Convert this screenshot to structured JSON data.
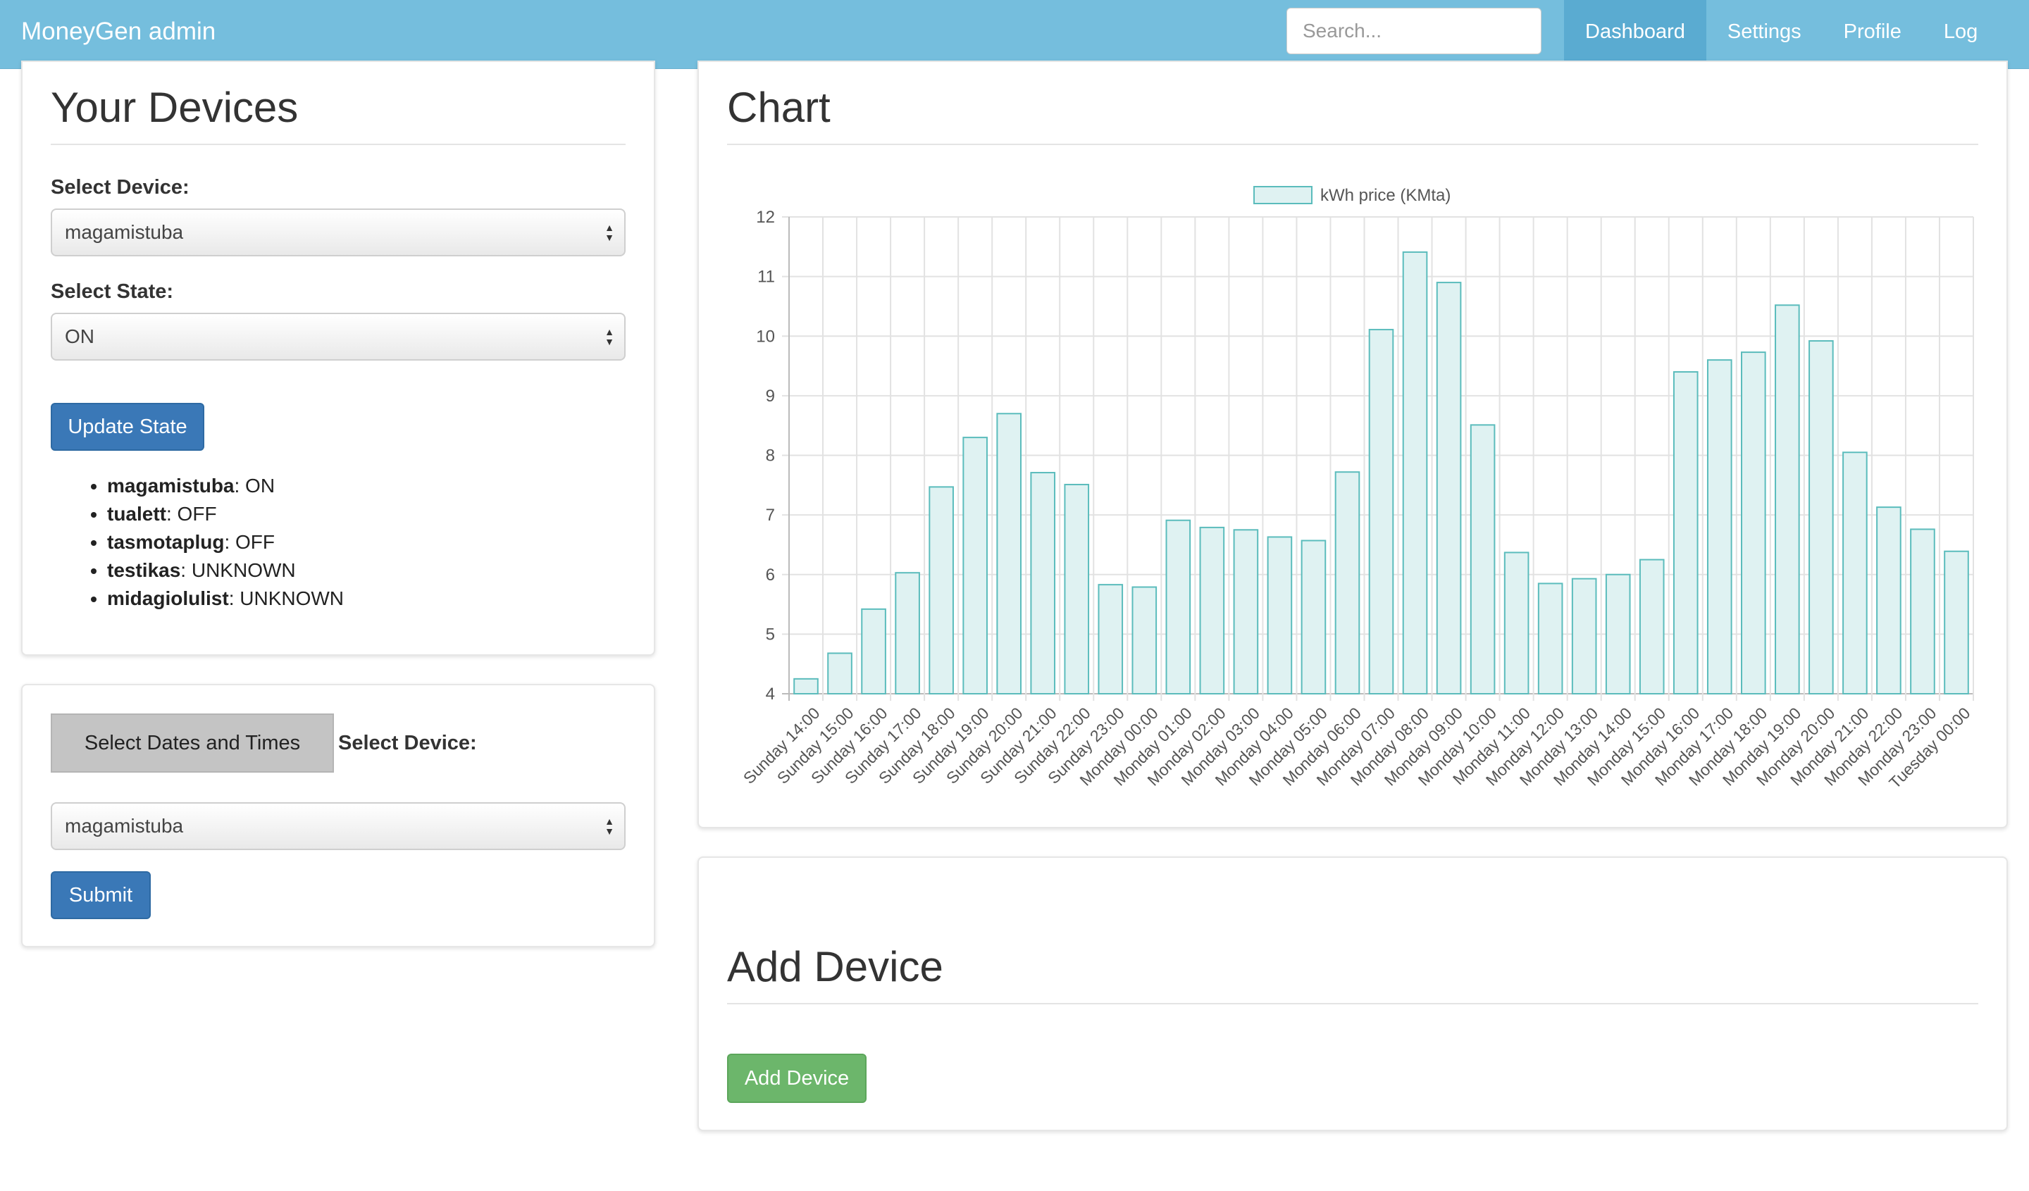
{
  "navbar": {
    "brand": "MoneyGen admin",
    "search_placeholder": "Search...",
    "links": [
      "Dashboard",
      "Settings",
      "Profile",
      "Log Out"
    ],
    "active": "Dashboard"
  },
  "devices_panel": {
    "title": "Your Devices",
    "select_device_label": "Select Device:",
    "selected_device": "magamistuba",
    "select_state_label": "Select State:",
    "selected_state": "ON",
    "update_button": "Update State",
    "device_states": [
      {
        "name": "magamistuba",
        "state": ": ON"
      },
      {
        "name": "tualett",
        "state": ": OFF"
      },
      {
        "name": "tasmotaplug",
        "state": ": OFF"
      },
      {
        "name": "testikas",
        "state": ": UNKNOWN"
      },
      {
        "name": "midagiolulist",
        "state": ": UNKNOWN"
      }
    ]
  },
  "dates_panel": {
    "select_dates_button": "Select Dates and Times",
    "select_device_label": "Select Device:",
    "selected_device": "magamistuba",
    "submit_button": "Submit"
  },
  "chart_panel": {
    "title": "Chart"
  },
  "add_device_panel": {
    "title": "Add Device",
    "button": "Add Device"
  },
  "colors": {
    "navbar": "#75bedd",
    "bar_fill": "#dff2f2",
    "bar_stroke": "#5bbcbc",
    "primary": "#3a78b7",
    "success": "#6cb66b"
  },
  "chart_data": {
    "type": "bar",
    "series": [
      {
        "name": "kWh price (KMta)",
        "values": [
          4.25,
          4.68,
          5.42,
          6.03,
          7.47,
          8.3,
          8.7,
          7.71,
          7.51,
          5.83,
          5.79,
          6.91,
          6.79,
          6.75,
          6.63,
          6.57,
          7.72,
          10.11,
          11.41,
          10.9,
          8.51,
          6.37,
          5.85,
          5.93,
          6.0,
          6.25,
          9.4,
          9.6,
          9.73,
          10.52,
          9.92,
          8.05,
          7.13,
          6.76,
          6.39
        ]
      }
    ],
    "categories": [
      "Sunday 14:00",
      "Sunday 15:00",
      "Sunday 16:00",
      "Sunday 17:00",
      "Sunday 18:00",
      "Sunday 19:00",
      "Sunday 20:00",
      "Sunday 21:00",
      "Sunday 22:00",
      "Sunday 23:00",
      "Monday 00:00",
      "Monday 01:00",
      "Monday 02:00",
      "Monday 03:00",
      "Monday 04:00",
      "Monday 05:00",
      "Monday 06:00",
      "Monday 07:00",
      "Monday 08:00",
      "Monday 09:00",
      "Monday 10:00",
      "Monday 11:00",
      "Monday 12:00",
      "Monday 13:00",
      "Monday 14:00",
      "Monday 15:00",
      "Monday 16:00",
      "Monday 17:00",
      "Monday 18:00",
      "Monday 19:00",
      "Monday 20:00",
      "Monday 21:00",
      "Monday 22:00",
      "Monday 23:00",
      "Tuesday 00:00"
    ],
    "ylim": [
      4,
      12
    ],
    "yticks": [
      4,
      5,
      6,
      7,
      8,
      9,
      10,
      11,
      12
    ],
    "grid": true,
    "legend": "top-center"
  }
}
